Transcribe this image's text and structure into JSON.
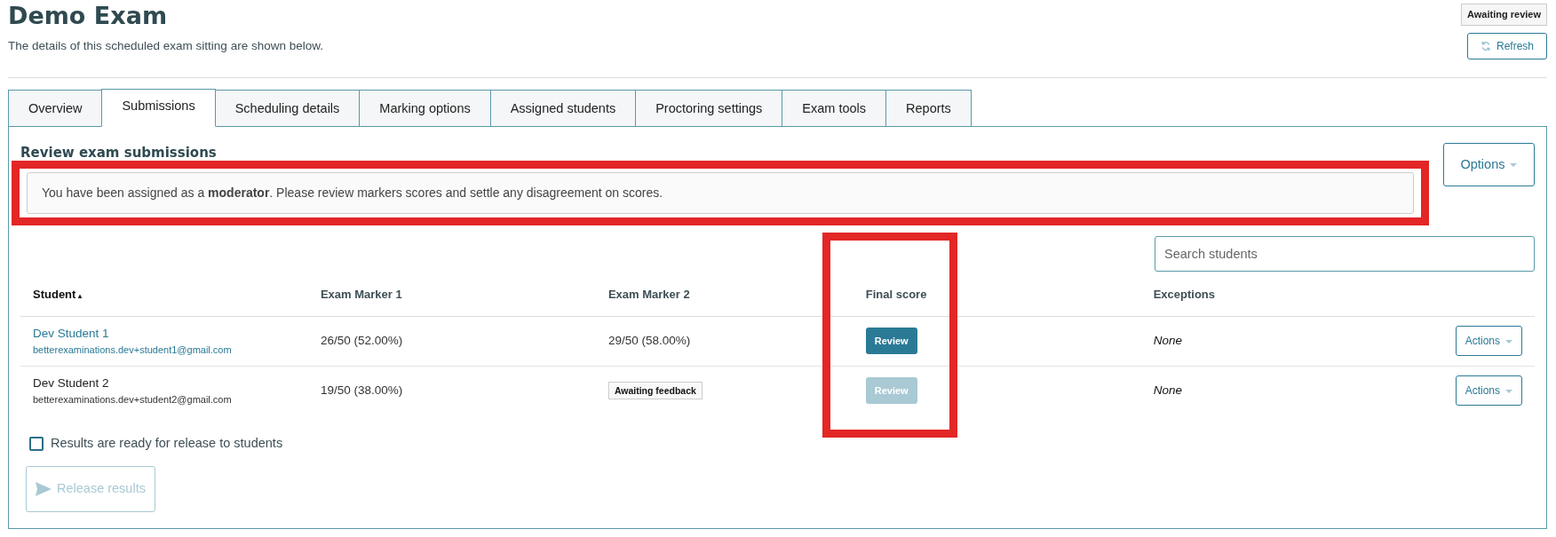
{
  "header": {
    "title": "Demo Exam",
    "subtitle": "The details of this scheduled exam sitting are shown below.",
    "status_badge": "Awaiting review",
    "refresh_button": "Refresh"
  },
  "tabs": [
    {
      "label": "Overview",
      "selected": false
    },
    {
      "label": "Submissions",
      "selected": true
    },
    {
      "label": "Scheduling details",
      "selected": false
    },
    {
      "label": "Marking options",
      "selected": false
    },
    {
      "label": "Assigned students",
      "selected": false
    },
    {
      "label": "Proctoring settings",
      "selected": false
    },
    {
      "label": "Exam tools",
      "selected": false
    },
    {
      "label": "Reports",
      "selected": false
    }
  ],
  "panel": {
    "heading": "Review exam submissions",
    "notice": {
      "text": "You have been assigned as a **moderator**. Please review markers scores and settle any disagreement on scores.",
      "highlighted": true
    },
    "options_button": "Options",
    "search": {
      "placeholder": "Search students"
    },
    "table": {
      "columns": [
        {
          "label": "Student",
          "sort": "▴",
          "highlighted": false
        },
        {
          "label": "Exam Marker 1",
          "highlighted": false
        },
        {
          "label": "Exam Marker 2",
          "highlighted": false
        },
        {
          "label": "Final score",
          "highlighted": true
        },
        {
          "label": "Exceptions",
          "highlighted": false
        }
      ],
      "rows": [
        {
          "name": "Dev Student 1",
          "linked": true,
          "email": "betterexaminations.dev+student1@gmail.com",
          "marker_1": {
            "kind": "score",
            "text": "26/50 (52.00%)"
          },
          "marker_2": {
            "kind": "score",
            "text": "29/50 (58.00%)"
          },
          "final": {
            "label": "Review",
            "disabled": false
          },
          "exceptions": "None",
          "actions": "Actions"
        },
        {
          "name": "Dev Student 2",
          "linked": false,
          "email": "betterexaminations.dev+student2@gmail.com",
          "marker_1": {
            "kind": "score",
            "text": "19/50 (38.00%)"
          },
          "marker_2": {
            "kind": "badge",
            "text": "Awaiting feedback"
          },
          "final": {
            "label": "Review",
            "disabled": true
          },
          "exceptions": "None",
          "actions": "Actions"
        }
      ]
    },
    "release_checkbox": {
      "label": "Results are ready for release to students",
      "checked": false
    },
    "release_button": {
      "label": "Release results",
      "disabled": true
    }
  }
}
